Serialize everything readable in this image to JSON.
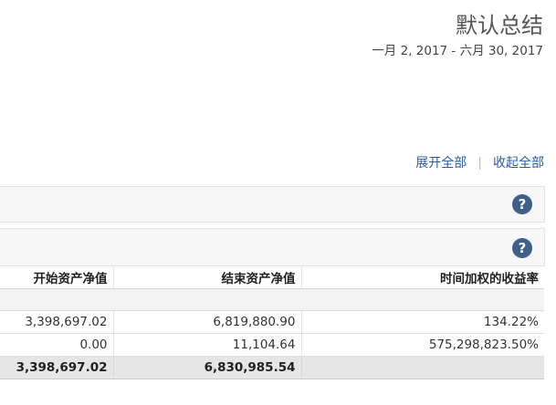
{
  "report": {
    "title": "默认总结",
    "date_range": "一月 2, 2017 - 六月 30, 2017"
  },
  "actions": {
    "expand_all": "展开全部",
    "separator": "|",
    "collapse_all": "收起全部"
  },
  "icons": {
    "help": "?"
  },
  "table": {
    "headers": [
      "开始资产净值",
      "结束资产净值",
      "时间加权的收益率"
    ],
    "rows": [
      [
        "3,398,697.02",
        "6,819,880.90",
        "134.22%"
      ],
      [
        "0.00",
        "11,104.64",
        "575,298,823.50%"
      ]
    ],
    "total": [
      "3,398,697.02",
      "6,830,985.54",
      ""
    ]
  },
  "colors": {
    "link": "#2a5aa5",
    "help_icon_bg": "#3e5f8a",
    "total_row_bg": "#e6e6e6"
  }
}
